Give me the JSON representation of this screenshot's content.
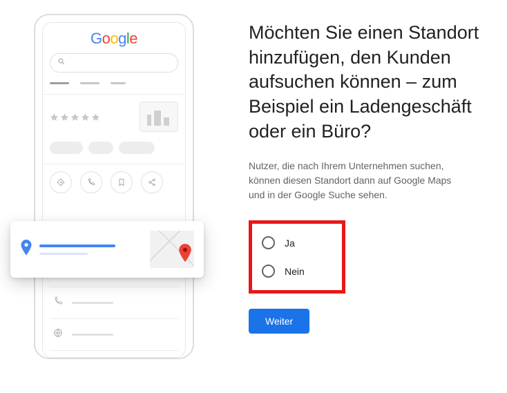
{
  "brand": {
    "name": "Google"
  },
  "form": {
    "heading": "Möchten Sie einen Standort hinzufügen, den Kunden aufsuchen können – zum Beispiel ein Ladengeschäft oder ein Büro?",
    "subtext": "Nutzer, die nach Ihrem Unternehmen suchen, können diesen Standort dann auf Google Maps und in der Google Suche sehen.",
    "options": {
      "yes": "Ja",
      "no": "Nein"
    },
    "submit": "Weiter"
  },
  "highlight_color": "#e81818",
  "accent_color": "#1a73e8"
}
